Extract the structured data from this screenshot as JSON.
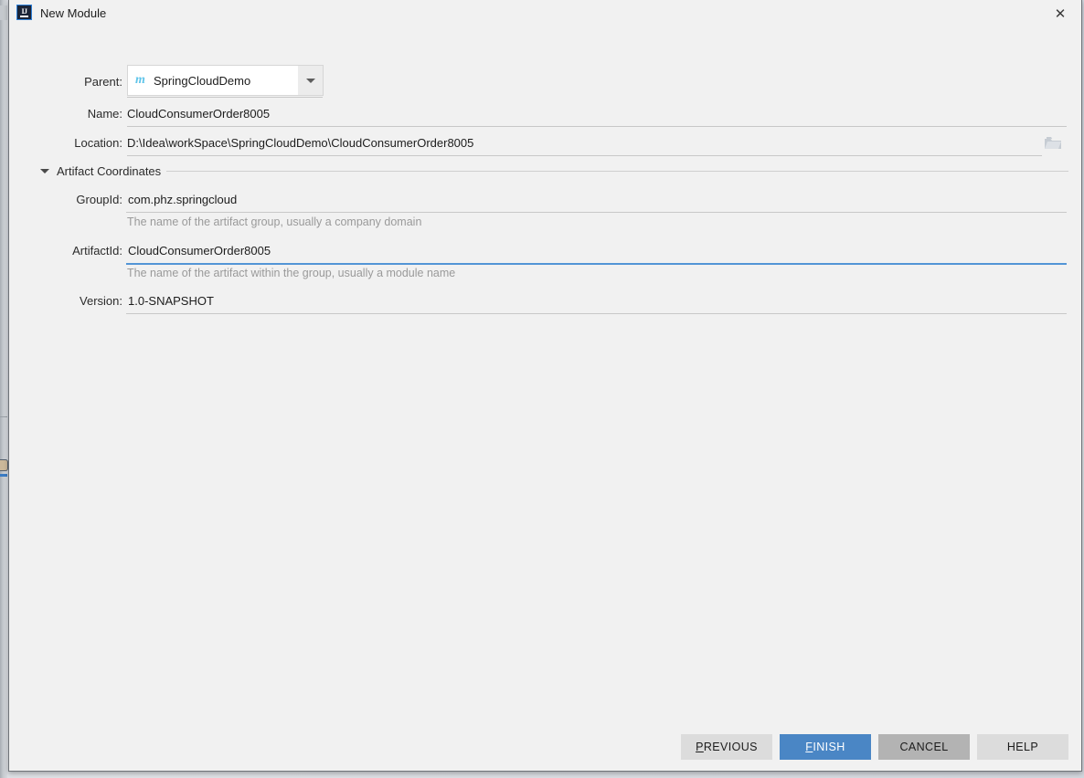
{
  "window": {
    "title": "New Module",
    "app_icon": "intellij-idea-icon",
    "close_icon": "close-icon"
  },
  "form": {
    "parent": {
      "label": "Parent:",
      "value": "SpringCloudDemo",
      "icon": "maven-module-icon",
      "dropdown_icon": "chevron-down-icon"
    },
    "name": {
      "label": "Name:",
      "value": "CloudConsumerOrder8005"
    },
    "location": {
      "label": "Location:",
      "value": "D:\\Idea\\workSpace\\SpringCloudDemo\\CloudConsumerOrder8005",
      "browse_icon": "folder-icon"
    },
    "artifact_coordinates": {
      "section_label": "Artifact Coordinates",
      "expander_icon": "triangle-down-icon",
      "group_id": {
        "label": "GroupId:",
        "value": "com.phz.springcloud",
        "hint": "The name of the artifact group, usually a company domain"
      },
      "artifact_id": {
        "label": "ArtifactId:",
        "value": "CloudConsumerOrder8005",
        "hint": "The name of the artifact within the group, usually a module name",
        "focused": true
      },
      "version": {
        "label": "Version:",
        "value": "1.0-SNAPSHOT"
      }
    }
  },
  "buttons": {
    "previous": {
      "label": "PREVIOUS",
      "mnemonic": "P",
      "rest": "REVIOUS"
    },
    "finish": {
      "label": "FINISH",
      "mnemonic": "F",
      "rest": "INISH"
    },
    "cancel": {
      "label": "CANCEL"
    },
    "help": {
      "label": "HELP"
    }
  },
  "colors": {
    "accent": "#4a86c5",
    "focus_underline": "#5295d6",
    "dialog_bg": "#f1f1f1",
    "hint_text": "#9a9a9a"
  }
}
